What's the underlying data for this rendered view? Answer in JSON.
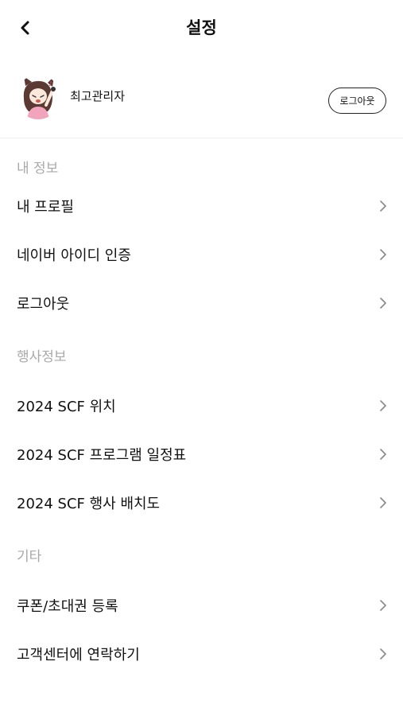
{
  "header": {
    "title": "설정"
  },
  "profile": {
    "name": "최고관리자",
    "logout_label": "로그아웃"
  },
  "sections": {
    "my_info": {
      "title": "내 정보",
      "items": [
        {
          "label": "내 프로필"
        },
        {
          "label": "네이버 아이디 인증"
        },
        {
          "label": "로그아웃"
        }
      ]
    },
    "event_info": {
      "title": "행사정보",
      "items": [
        {
          "label": "2024 SCF 위치"
        },
        {
          "label": "2024 SCF 프로그램 일정표"
        },
        {
          "label": "2024 SCF 행사 배치도"
        }
      ]
    },
    "etc": {
      "title": "기타",
      "items": [
        {
          "label": "쿠폰/초대권 등록"
        },
        {
          "label": "고객센터에 연락하기"
        }
      ]
    }
  },
  "icons": {
    "back": "back-arrow-icon",
    "chevron": "chevron-right-icon"
  }
}
